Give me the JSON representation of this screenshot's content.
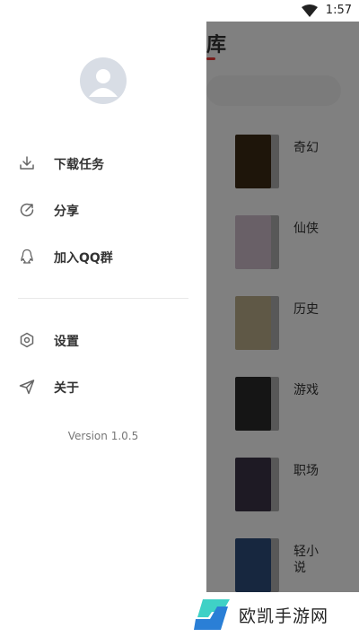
{
  "status_bar": {
    "time": "1:57"
  },
  "background_app": {
    "title_fragment": "库",
    "categories": [
      {
        "label": "奇幻",
        "cover_color": "#3b2a14"
      },
      {
        "label": "仙侠",
        "cover_color": "#c9b9c6"
      },
      {
        "label": "历史",
        "cover_color": "#b7a987"
      },
      {
        "label": "游戏",
        "cover_color": "#2a2a2a"
      },
      {
        "label": "职场",
        "cover_color": "#3a3346"
      },
      {
        "label": "轻小说",
        "cover_color": "#2d4c7a"
      }
    ]
  },
  "drawer": {
    "menu_primary": [
      {
        "label": "下载任务",
        "icon": "download-icon"
      },
      {
        "label": "分享",
        "icon": "share-icon"
      },
      {
        "label": "加入QQ群",
        "icon": "qq-icon"
      }
    ],
    "menu_secondary": [
      {
        "label": "设置",
        "icon": "settings-icon"
      },
      {
        "label": "关于",
        "icon": "send-icon"
      }
    ],
    "version": "Version 1.0.5"
  },
  "watermark": {
    "text": "欧凯手游网"
  }
}
